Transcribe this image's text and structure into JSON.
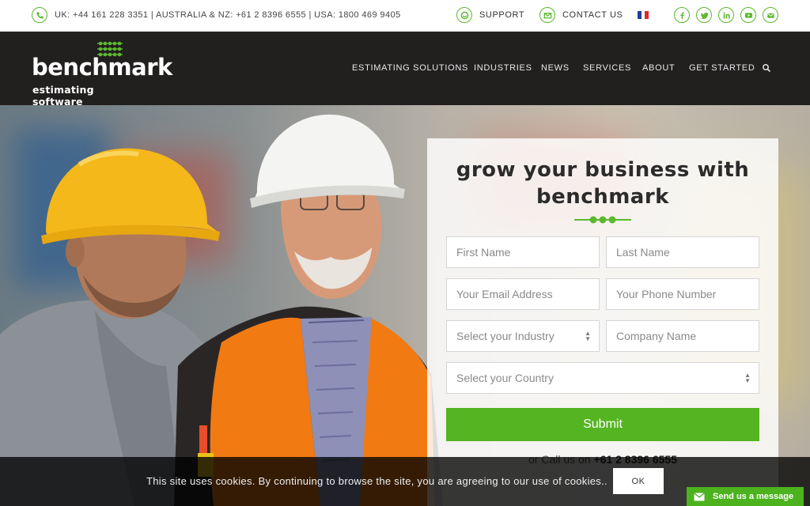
{
  "topbar": {
    "phones": "UK: +44 161 228 3351 | AUSTRALIA & NZ: +61 2 8396 6555 | USA: 1800 469 9405",
    "support_label": "SUPPORT",
    "contact_label": "CONTACT US",
    "language_flag": "french-flag",
    "social": [
      "facebook-icon",
      "twitter-icon",
      "linkedin-icon",
      "youtube-icon",
      "email-icon"
    ]
  },
  "logo": {
    "wordmark": "benchmark",
    "tagline": "estimating software"
  },
  "nav": {
    "items": [
      "ESTIMATING SOLUTIONS",
      "INDUSTRIES",
      "NEWS",
      "SERVICES",
      "ABOUT",
      "GET STARTED"
    ],
    "search_icon": "search-icon"
  },
  "form": {
    "title_line1": "grow your business with",
    "title_line2": "benchmark",
    "first_name": "First Name",
    "last_name": "Last Name",
    "email": "Your Email Address",
    "phone": "Your Phone Number",
    "industry": "Select your Industry",
    "company": "Company Name",
    "country": "Select your Country",
    "submit_label": "Submit",
    "call_prefix": "or Call us on",
    "call_number": "+61 2 8396 6555"
  },
  "cookie": {
    "text": "This site uses cookies. By continuing to browse the site, you are agreeing to our use of cookies..",
    "ok_label": "OK"
  },
  "chat": {
    "label": "Send us a message"
  },
  "colors": {
    "accent": "#5cb82e",
    "header_bg": "#221f1f",
    "submit_bg": "#55b421"
  }
}
